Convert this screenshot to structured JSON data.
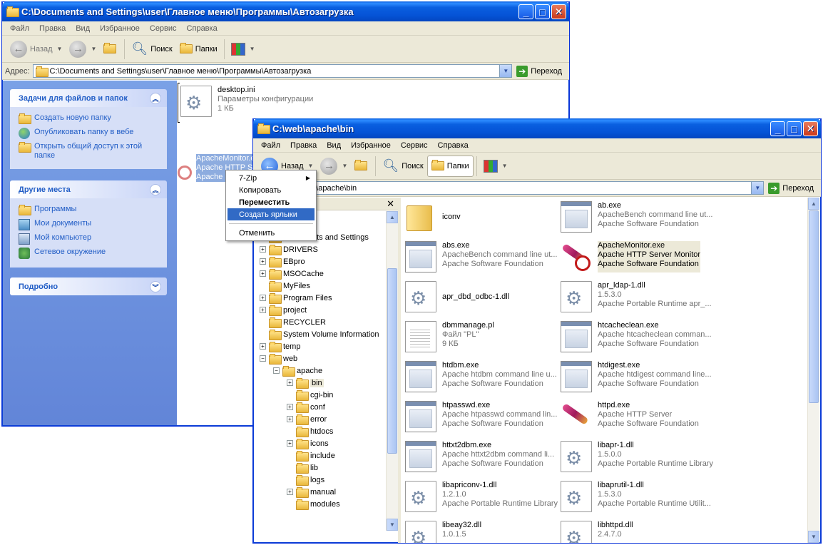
{
  "window1": {
    "title": "C:\\Documents and Settings\\user\\Главное меню\\Программы\\Автозагрузка",
    "menu": [
      "Файл",
      "Правка",
      "Вид",
      "Избранное",
      "Сервис",
      "Справка"
    ],
    "toolbar": {
      "back": "Назад",
      "search": "Поиск",
      "folders": "Папки"
    },
    "address_label": "Адрес:",
    "address": "C:\\Documents and Settings\\user\\Главное меню\\Программы\\Автозагрузка",
    "go": "Переход",
    "tasks": {
      "file_tasks_title": "Задачи для файлов и папок",
      "file_tasks": [
        "Создать новую папку",
        "Опубликовать папку в вебе",
        "Открыть общий доступ к этой папке"
      ],
      "other_places_title": "Другие места",
      "other_places": [
        "Программы",
        "Мои документы",
        "Мой компьютер",
        "Сетевое окружение"
      ],
      "details_title": "Подробно"
    },
    "file": {
      "name": "desktop.ini",
      "type": "Параметры конфигурации",
      "size": "1 КБ"
    },
    "drag_ghost": [
      "ApacheMonitor.exe",
      "Apache HTTP Se...",
      "Apache Softw..."
    ]
  },
  "context_menu": {
    "items": [
      "7-Zip",
      "Копировать",
      "Переместить",
      "Создать ярлыки",
      "Отменить"
    ]
  },
  "window2": {
    "title": "C:\\web\\apache\\bin",
    "menu": [
      "Файл",
      "Правка",
      "Вид",
      "Избранное",
      "Сервис",
      "Справка"
    ],
    "toolbar": {
      "back": "Назад",
      "search": "Поиск",
      "folders": "Папки"
    },
    "address": "C:\\web\\apache\\bin",
    "address_visible": "web\\apache\\bin",
    "go": "Переход",
    "tree": [
      {
        "label": "si",
        "pm": "",
        "indent": 0
      },
      {
        "label": "distrib",
        "pm": "+",
        "indent": 0
      },
      {
        "label": "Documents and Settings",
        "pm": "+",
        "indent": 0
      },
      {
        "label": "DRIVERS",
        "pm": "+",
        "indent": 0
      },
      {
        "label": "EBpro",
        "pm": "+",
        "indent": 0
      },
      {
        "label": "MSOCache",
        "pm": "+",
        "indent": 0
      },
      {
        "label": "MyFiles",
        "pm": "",
        "indent": 0
      },
      {
        "label": "Program Files",
        "pm": "+",
        "indent": 0
      },
      {
        "label": "project",
        "pm": "+",
        "indent": 0
      },
      {
        "label": "RECYCLER",
        "pm": "",
        "indent": 0
      },
      {
        "label": "System Volume Information",
        "pm": "",
        "indent": 0
      },
      {
        "label": "temp",
        "pm": "+",
        "indent": 0
      },
      {
        "label": "web",
        "pm": "−",
        "indent": 0
      },
      {
        "label": "apache",
        "pm": "−",
        "indent": 1
      },
      {
        "label": "bin",
        "pm": "+",
        "indent": 2
      },
      {
        "label": "cgi-bin",
        "pm": "",
        "indent": 2
      },
      {
        "label": "conf",
        "pm": "+",
        "indent": 2
      },
      {
        "label": "error",
        "pm": "+",
        "indent": 2
      },
      {
        "label": "htdocs",
        "pm": "",
        "indent": 2
      },
      {
        "label": "icons",
        "pm": "+",
        "indent": 2
      },
      {
        "label": "include",
        "pm": "",
        "indent": 2
      },
      {
        "label": "lib",
        "pm": "",
        "indent": 2
      },
      {
        "label": "logs",
        "pm": "",
        "indent": 2
      },
      {
        "label": "manual",
        "pm": "+",
        "indent": 2
      },
      {
        "label": "modules",
        "pm": "",
        "indent": 2
      }
    ],
    "files": [
      {
        "name": "iconv",
        "l2": "",
        "l3": "",
        "icon": "folder"
      },
      {
        "name": "ab.exe",
        "l2": "ApacheBench command line ut...",
        "l3": "Apache Software Foundation",
        "icon": "exe"
      },
      {
        "name": "abs.exe",
        "l2": "ApacheBench command line ut...",
        "l3": "Apache Software Foundation",
        "icon": "exe"
      },
      {
        "name": "ApacheMonitor.exe",
        "l2": "Apache HTTP Server Monitor",
        "l3": "Apache Software Foundation",
        "icon": "monitor"
      },
      {
        "name": "apr_dbd_odbc-1.dll",
        "l2": "",
        "l3": "",
        "icon": "dll"
      },
      {
        "name": "apr_ldap-1.dll",
        "l2": "1.5.3.0",
        "l3": "Apache Portable Runtime apr_...",
        "icon": "dll"
      },
      {
        "name": "dbmmanage.pl",
        "l2": "Файл \"PL\"",
        "l3": "9 КБ",
        "icon": "doc"
      },
      {
        "name": "htcacheclean.exe",
        "l2": "Apache htcacheclean comman...",
        "l3": "Apache Software Foundation",
        "icon": "exe"
      },
      {
        "name": "htdbm.exe",
        "l2": "Apache htdbm command line u...",
        "l3": "Apache Software Foundation",
        "icon": "exe"
      },
      {
        "name": "htdigest.exe",
        "l2": "Apache htdigest command line...",
        "l3": "Apache Software Foundation",
        "icon": "exe"
      },
      {
        "name": "htpasswd.exe",
        "l2": "Apache htpasswd command lin...",
        "l3": "Apache Software Foundation",
        "icon": "exe"
      },
      {
        "name": "httpd.exe",
        "l2": "Apache HTTP Server",
        "l3": "Apache Software Foundation",
        "icon": "feather"
      },
      {
        "name": "httxt2dbm.exe",
        "l2": "Apache httxt2dbm command li...",
        "l3": "Apache Software Foundation",
        "icon": "exe"
      },
      {
        "name": "libapr-1.dll",
        "l2": "1.5.0.0",
        "l3": "Apache Portable Runtime Library",
        "icon": "dll"
      },
      {
        "name": "libapriconv-1.dll",
        "l2": "1.2.1.0",
        "l3": "Apache Portable Runtime Library",
        "icon": "dll"
      },
      {
        "name": "libaprutil-1.dll",
        "l2": "1.5.3.0",
        "l3": "Apache Portable Runtime Utilit...",
        "icon": "dll"
      },
      {
        "name": "libeay32.dll",
        "l2": "1.0.1.5",
        "l3": "",
        "icon": "dll"
      },
      {
        "name": "libhttpd.dll",
        "l2": "2.4.7.0",
        "l3": "",
        "icon": "dll"
      }
    ]
  },
  "colors": {
    "xp_title": "#0a5fe0",
    "task_pane": "#6b8fdf",
    "menu_highlight": "#316ac5"
  }
}
